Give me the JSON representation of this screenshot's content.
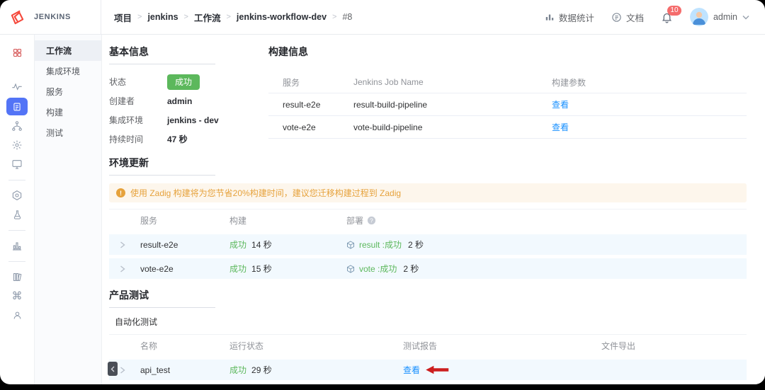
{
  "brand": "JENKINS",
  "header": {
    "breadcrumb": [
      "项目",
      "jenkins",
      "工作流",
      "jenkins-workflow-dev",
      "#8"
    ],
    "breadcrumb_sep": ">",
    "stats_label": "数据统计",
    "docs_label": "文档",
    "notification_count": "10",
    "username": "admin"
  },
  "rail": {
    "icons": [
      "dashboard-icon",
      "activity-icon",
      "projects-icon",
      "pipelines-icon",
      "integrations-icon",
      "screen-icon",
      "kubernetes-icon",
      "lab-icon",
      "statistics-icon",
      "library-icon",
      "command-icon",
      "profile-icon"
    ],
    "command_glyph": "⌘"
  },
  "sidebar": {
    "items": [
      {
        "label": "工作流",
        "active": true
      },
      {
        "label": "集成环境",
        "active": false
      },
      {
        "label": "服务",
        "active": false
      },
      {
        "label": "构建",
        "active": false
      },
      {
        "label": "测试",
        "active": false
      }
    ]
  },
  "basic_info": {
    "title": "基本信息",
    "fields": [
      {
        "label": "状态",
        "value": "成功"
      },
      {
        "label": "创建者",
        "value": "admin"
      },
      {
        "label": "集成环境",
        "value": "jenkins - dev"
      },
      {
        "label": "持续时间",
        "value": "47 秒"
      }
    ]
  },
  "build_info": {
    "title": "构建信息",
    "columns": [
      "服务",
      "Jenkins Job Name",
      "构建参数"
    ],
    "rows": [
      {
        "service": "result-e2e",
        "job": "result-build-pipeline",
        "action": "查看"
      },
      {
        "service": "vote-e2e",
        "job": "vote-build-pipeline",
        "action": "查看"
      }
    ]
  },
  "env_update": {
    "title": "环境更新",
    "notice": "使用 Zadig 构建将为您节省20%构建时间，建议您迁移构建过程到 Zadig",
    "columns": [
      "服务",
      "构建",
      "部署"
    ],
    "rows": [
      {
        "service": "result-e2e",
        "build_status": "成功",
        "build_time": "14 秒",
        "deploy_text": "result :成功",
        "deploy_time": "2 秒"
      },
      {
        "service": "vote-e2e",
        "build_status": "成功",
        "build_time": "15 秒",
        "deploy_text": "vote :成功",
        "deploy_time": "2 秒"
      }
    ]
  },
  "product_test": {
    "title": "产品测试",
    "subtitle": "自动化测试",
    "columns": [
      "名称",
      "运行状态",
      "测试报告",
      "文件导出"
    ],
    "rows": [
      {
        "name": "api_test",
        "status": "成功",
        "time": "29 秒",
        "report": "查看"
      }
    ]
  },
  "colors": {
    "success": "#5cb85c",
    "link": "#1890ff",
    "warning": "#e6a23c",
    "accent": "#5374f6"
  }
}
